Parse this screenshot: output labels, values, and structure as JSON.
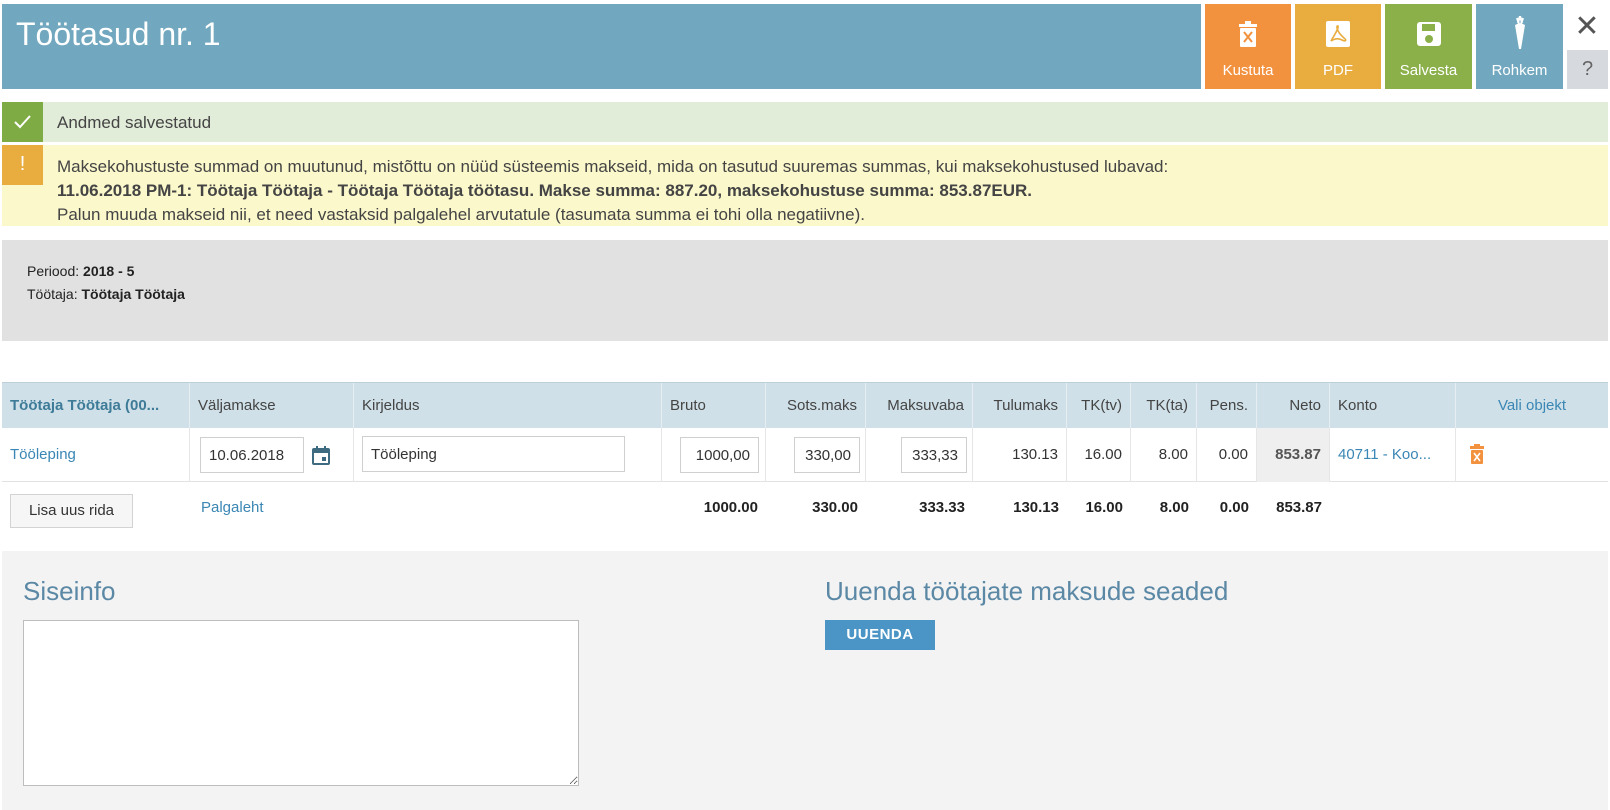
{
  "header": {
    "title": "Töötasud nr. 1",
    "buttons": {
      "delete": "Kustuta",
      "pdf": "PDF",
      "save": "Salvesta",
      "more": "Rohkem"
    },
    "close_symbol": "✕",
    "help_symbol": "?"
  },
  "alerts": {
    "success": {
      "text": "Andmed salvestatud",
      "icon": "check-icon"
    },
    "warning": {
      "icon_symbol": "!",
      "line1": "Maksekohustuste summad on muutunud, mistõttu on nüüd süsteemis makseid, mida on tasutud suuremas summas, kui maksekohustused lubavad:",
      "line2": "11.06.2018 PM-1: Töötaja Töötaja - Töötaja Töötaja töötasu. Makse summa: 887.20, maksekohustuse summa: 853.87EUR.",
      "line3": "Palun muuda makseid nii, et need vastaksid palgalehel arvutatule (tasumata summa ei tohi olla negatiivne)."
    }
  },
  "info": {
    "period_label": "Periood:",
    "period_value": "2018 - 5",
    "employee_label": "Töötaja:",
    "employee_value": "Töötaja Töötaja"
  },
  "table": {
    "columns": {
      "employee": "Töötaja Töötaja (00...",
      "payout": "Väljamakse",
      "description": "Kirjeldus",
      "gross": "Bruto",
      "social_tax": "Sots.maks",
      "tax_free": "Maksuvaba",
      "income_tax": "Tulumaks",
      "tk_tv": "TK(tv)",
      "tk_ta": "TK(ta)",
      "pension": "Pens.",
      "net": "Neto",
      "account": "Konto",
      "select_object": "Vali objekt"
    },
    "row": {
      "type": "Tööleping",
      "payout_date": "10.06.2018",
      "description": "Tööleping",
      "gross": "1000,00",
      "social_tax": "330,00",
      "tax_free": "333,33",
      "income_tax": "130.13",
      "tk_tv": "16.00",
      "tk_ta": "8.00",
      "pension": "0.00",
      "net": "853.87",
      "account": "40711 - Koo..."
    },
    "totals": {
      "add_row_label": "Lisa uus rida",
      "payslip_link": "Palgaleht",
      "gross": "1000.00",
      "social_tax": "330.00",
      "tax_free": "333.33",
      "income_tax": "130.13",
      "tk_tv": "16.00",
      "tk_ta": "8.00",
      "pension": "0.00",
      "net": "853.87"
    }
  },
  "bottom": {
    "internal_info_title": "Siseinfo",
    "internal_info_value": "",
    "update_title": "Uuenda töötajate maksude seaded",
    "update_button": "UUENDA"
  },
  "colors": {
    "header_bg": "#72a8bf",
    "delete": "#f2913e",
    "pdf": "#e9ac3e",
    "save": "#8bb04a",
    "success": "#7fab45",
    "warning": "#e9ac3e",
    "link": "#3a86b4"
  }
}
